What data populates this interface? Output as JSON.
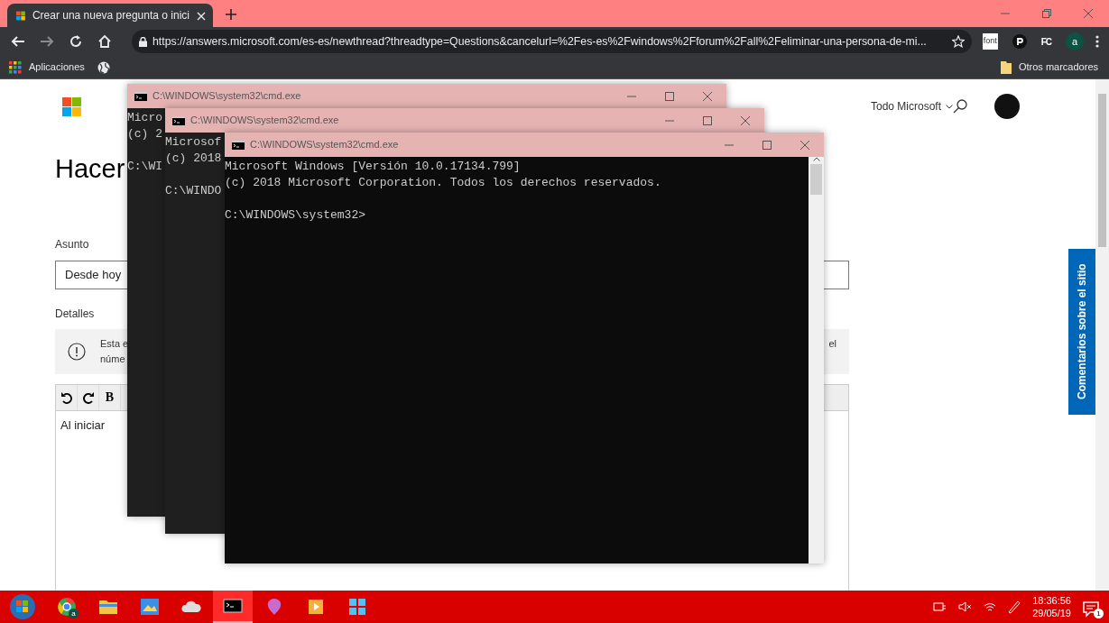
{
  "browser": {
    "tab": {
      "title": "Crear una nueva pregunta o inici",
      "selected": true
    },
    "nav": [
      {
        "kind": "back",
        "disabled": false
      },
      {
        "kind": "forward",
        "disabled": true
      },
      {
        "kind": "reload",
        "disabled": false
      },
      {
        "kind": "home",
        "disabled": false
      }
    ],
    "url": "https://answers.microsoft.com/es-es/newthread?threadtype=Questions&cancelurl=%2Fes-es%2Fwindows%2Fforum%2Fall%2Feliminar-una-persona-de-mi...",
    "extensions": [
      {
        "kind": "text",
        "label": "font"
      },
      {
        "kind": "pin"
      },
      {
        "kind": "text",
        "label": "FC"
      }
    ],
    "profile": "a",
    "bookmarks": [
      {
        "kind": "apps",
        "label": "Aplicaciones"
      },
      {
        "kind": "globe"
      }
    ],
    "other_bookmarks": "Otros marcadores"
  },
  "page": {
    "nav_menu": "Todo Microsoft",
    "heading": "Hacer",
    "subject_label": "Asunto",
    "subject_value": "Desde hoy",
    "details_label": "Detalles",
    "notice": {
      "line_1_start": "Esta e",
      "line_1_end": "el",
      "line_2_start": "núme"
    },
    "editor_toolbar": [
      {
        "kind": "undo"
      },
      {
        "kind": "redo"
      },
      {
        "kind": "text",
        "label": "B"
      }
    ],
    "editor_text": "Al iniciar",
    "feedback_tab": "Comentarios sobre el sitio"
  },
  "windows": [
    {
      "title": "C:\\WINDOWS\\system32\\cmd.exe",
      "paragraphs": [
        [
          "Micro",
          "(c) 2"
        ],
        [
          "C:\\WI"
        ]
      ]
    },
    {
      "title": "C:\\WINDOWS\\system32\\cmd.exe",
      "paragraphs": [
        [
          "Microsof",
          "(c) 2018"
        ],
        [
          "C:\\WINDO"
        ]
      ]
    },
    {
      "title": "C:\\WINDOWS\\system32\\cmd.exe",
      "paragraphs": [
        [
          "Microsoft Windows [Versión 10.0.17134.799]",
          "(c) 2018 Microsoft Corporation. Todos los derechos reservados."
        ],
        [
          "C:\\WINDOWS\\system32>"
        ]
      ]
    }
  ],
  "taskbar": {
    "apps": [
      {
        "kind": "browser",
        "badge": "a",
        "selected": false
      },
      {
        "kind": "folder",
        "selected": false
      },
      {
        "kind": "paint",
        "selected": false
      },
      {
        "kind": "cloud",
        "selected": false
      },
      {
        "kind": "console",
        "selected": true
      },
      {
        "kind": "balloon",
        "selected": false
      },
      {
        "kind": "media",
        "selected": false
      },
      {
        "kind": "store",
        "selected": false
      }
    ],
    "time": "18:36:56",
    "date": "29/05/19",
    "notifications": "1"
  }
}
